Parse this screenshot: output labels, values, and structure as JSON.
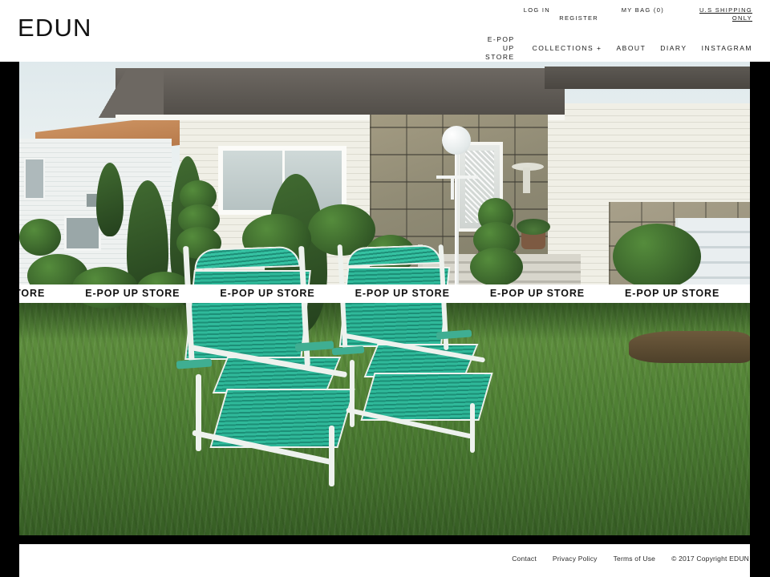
{
  "brand": {
    "logo": "EDUN"
  },
  "utility_nav": {
    "login": "LOG IN",
    "register": "REGISTER",
    "bag": "MY BAG (0)",
    "bag_count": 0,
    "shipping": "U.S SHIPPING ONLY"
  },
  "main_nav": {
    "items": [
      {
        "label": "E-POP UP STORE"
      },
      {
        "label": "COLLECTIONS +"
      },
      {
        "label": "ABOUT"
      },
      {
        "label": "DIARY"
      },
      {
        "label": "INSTAGRAM"
      }
    ]
  },
  "hero": {
    "alt": "Two teal strap lounge chairs on a suburban front lawn with a stone-faced ranch house, topiary shrubs and a white lamp post",
    "marquee_text": "E-POP UP STORE",
    "marquee_repeat": 8
  },
  "footer": {
    "links": [
      {
        "label": "Contact"
      },
      {
        "label": "Privacy Policy"
      },
      {
        "label": "Terms of Use"
      }
    ],
    "copyright": "© 2017 Copyright EDUN"
  },
  "colors": {
    "page_background": "#000000",
    "surface": "#ffffff",
    "text": "#1a1a1a",
    "chair_teal": "#2fb99a",
    "lawn_green": "#4e7f33"
  }
}
